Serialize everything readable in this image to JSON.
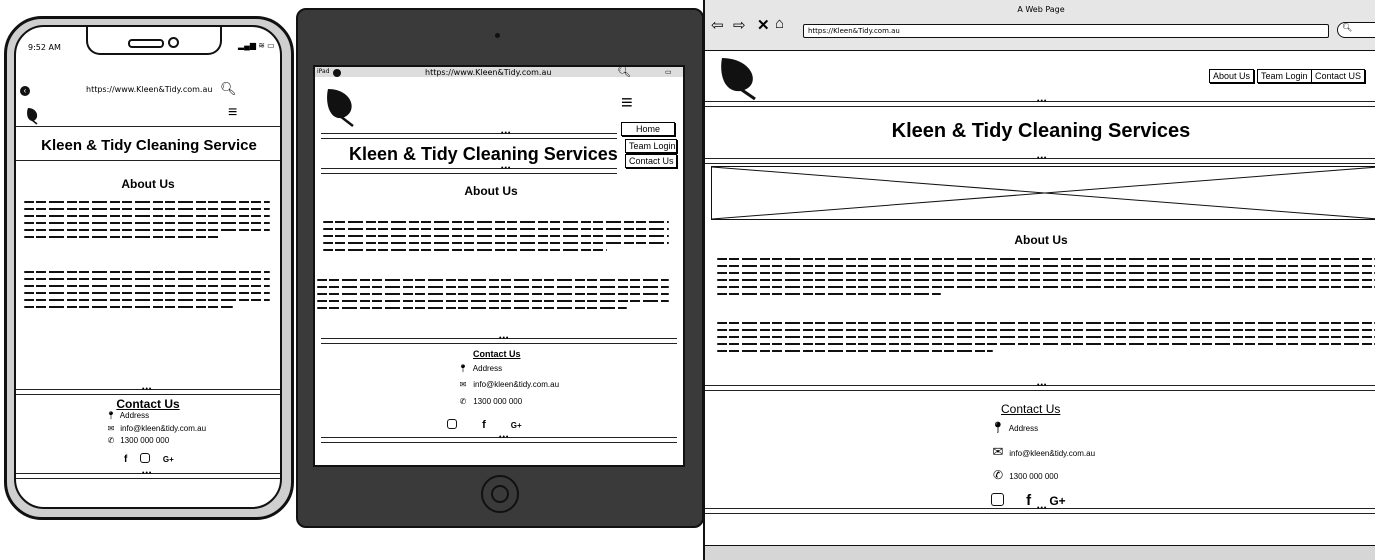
{
  "phone": {
    "status_time": "9:52 AM",
    "url": "https://www.Kleen&Tidy.com.au",
    "title": "Kleen & Tidy Cleaning Service",
    "about_heading": "About Us",
    "contact_heading": "Contact Us",
    "address": "Address",
    "email": "info@kleen&tidy.com.au",
    "phone_number": "1300 000 000",
    "social": [
      "f",
      "G+"
    ]
  },
  "tablet": {
    "status_left": "iPad",
    "url": "https://www.Kleen&Tidy.com.au",
    "title": "Kleen & Tidy Cleaning Services",
    "menu": [
      "Home",
      "Team Login",
      "Contact Us"
    ],
    "about_heading": "About Us",
    "contact_heading": "Contact Us",
    "address": "Address",
    "email": "info@kleen&tidy.com.au",
    "phone_number": "1300 000 000",
    "social": [
      "f",
      "G+"
    ]
  },
  "desktop": {
    "window_title": "A Web Page",
    "url": "https://Kleen&Tidy.com.au",
    "nav": [
      "About Us",
      "Team Login",
      "Contact US"
    ],
    "title": "Kleen & Tidy Cleaning Services",
    "about_heading": "About Us",
    "contact_heading": "Contact Us",
    "address": "Address",
    "email": "info@kleen&tidy.com.au",
    "phone_number": "1300 000 000",
    "social": [
      "f",
      "G+"
    ]
  }
}
